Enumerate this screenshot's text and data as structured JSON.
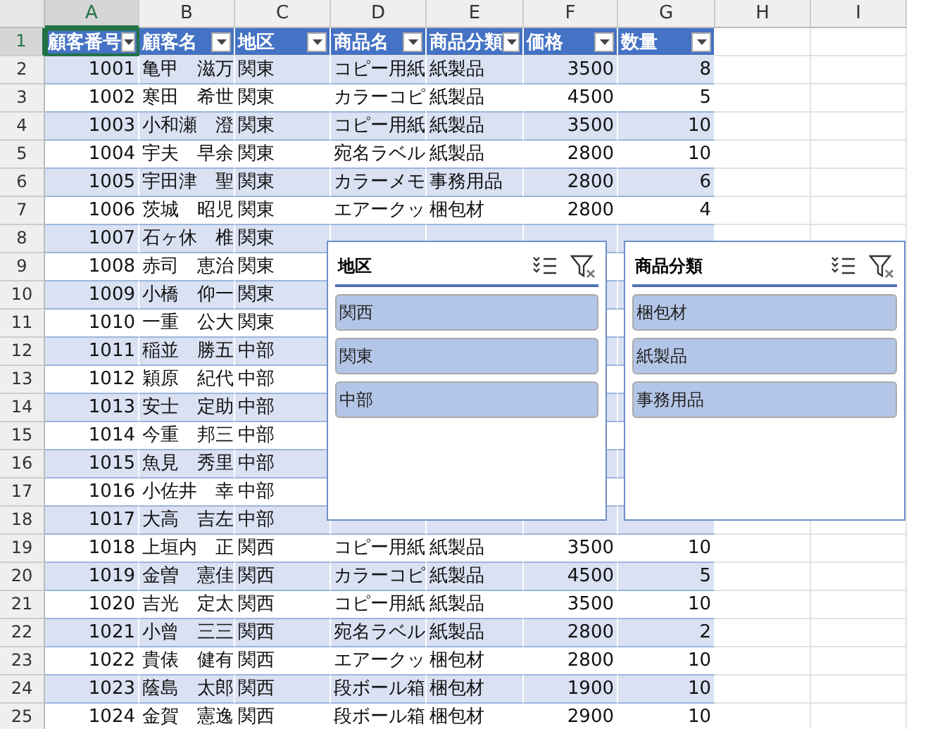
{
  "columns": [
    "A",
    "B",
    "C",
    "D",
    "E",
    "F",
    "G",
    "H",
    "I"
  ],
  "header": {
    "number": "1",
    "cells": [
      {
        "text": "顧客番号",
        "selected": true
      },
      {
        "text": "顧客名",
        "selected": false
      },
      {
        "text": "地区",
        "selected": false
      },
      {
        "text": "商品名",
        "selected": false
      },
      {
        "text": "商品分類",
        "selected": false
      },
      {
        "text": "価格",
        "selected": false
      },
      {
        "text": "数量",
        "selected": false
      }
    ]
  },
  "rows": [
    {
      "number": "2",
      "cells": [
        "1001",
        "亀甲　滋万",
        "関東",
        "コピー用紙",
        "紙製品",
        "3500",
        "8"
      ]
    },
    {
      "number": "3",
      "cells": [
        "1002",
        "寒田　希世",
        "関東",
        "カラーコピ",
        "紙製品",
        "4500",
        "5"
      ]
    },
    {
      "number": "4",
      "cells": [
        "1003",
        "小和瀬　澄",
        "関東",
        "コピー用紙",
        "紙製品",
        "3500",
        "10"
      ]
    },
    {
      "number": "5",
      "cells": [
        "1004",
        "宇夫　早余",
        "関東",
        "宛名ラベル",
        "紙製品",
        "2800",
        "10"
      ]
    },
    {
      "number": "6",
      "cells": [
        "1005",
        "宇田津　聖",
        "関東",
        "カラーメモ",
        "事務用品",
        "2800",
        "6"
      ]
    },
    {
      "number": "7",
      "cells": [
        "1006",
        "茨城　昭児",
        "関東",
        "エアークッ",
        "梱包材",
        "2800",
        "4"
      ]
    },
    {
      "number": "8",
      "cells": [
        "1007",
        "石ヶ休　椎",
        "関東"
      ]
    },
    {
      "number": "9",
      "cells": [
        "1008",
        "赤司　恵治",
        "関東"
      ]
    },
    {
      "number": "10",
      "cells": [
        "1009",
        "小橋　仰一",
        "関東"
      ]
    },
    {
      "number": "11",
      "cells": [
        "1010",
        "一重　公大",
        "関東"
      ]
    },
    {
      "number": "12",
      "cells": [
        "1011",
        "稲並　勝五",
        "中部"
      ]
    },
    {
      "number": "13",
      "cells": [
        "1012",
        "穎原　紀代",
        "中部"
      ]
    },
    {
      "number": "14",
      "cells": [
        "1013",
        "安士　定助",
        "中部"
      ]
    },
    {
      "number": "15",
      "cells": [
        "1014",
        "今重　邦三",
        "中部"
      ]
    },
    {
      "number": "16",
      "cells": [
        "1015",
        "魚見　秀里",
        "中部"
      ]
    },
    {
      "number": "17",
      "cells": [
        "1016",
        "小佐井　幸",
        "中部"
      ]
    },
    {
      "number": "18",
      "cells": [
        "1017",
        "大高　吉左",
        "中部"
      ]
    },
    {
      "number": "19",
      "cells": [
        "1018",
        "上垣内　正",
        "関西",
        "コピー用紙",
        "紙製品",
        "3500",
        "10"
      ]
    },
    {
      "number": "20",
      "cells": [
        "1019",
        "金曽　憲佳",
        "関西",
        "カラーコピ",
        "紙製品",
        "4500",
        "5"
      ]
    },
    {
      "number": "21",
      "cells": [
        "1020",
        "吉光　定太",
        "関西",
        "コピー用紙",
        "紙製品",
        "3500",
        "10"
      ]
    },
    {
      "number": "22",
      "cells": [
        "1021",
        "小曾　三三",
        "関西",
        "宛名ラベル",
        "紙製品",
        "2800",
        "2"
      ]
    },
    {
      "number": "23",
      "cells": [
        "1022",
        "貴俵　健有",
        "関西",
        "エアークッ",
        "梱包材",
        "2800",
        "10"
      ]
    },
    {
      "number": "24",
      "cells": [
        "1023",
        "蔭島　太郎",
        "関西",
        "段ボール箱",
        "梱包材",
        "1900",
        "10"
      ]
    },
    {
      "number": "25",
      "cells": [
        "1024",
        "金賀　憲逸",
        "関西",
        "段ボール箱",
        "梱包材",
        "2900",
        "10"
      ]
    }
  ],
  "slicers": [
    {
      "title": "地区",
      "items": [
        {
          "label": "関西",
          "selected": true
        },
        {
          "label": "関東",
          "selected": true
        },
        {
          "label": "中部",
          "selected": true
        }
      ]
    },
    {
      "title": "商品分類",
      "items": [
        {
          "label": "梱包材",
          "selected": true
        },
        {
          "label": "紙製品",
          "selected": true
        },
        {
          "label": "事務用品",
          "selected": true
        }
      ]
    }
  ]
}
